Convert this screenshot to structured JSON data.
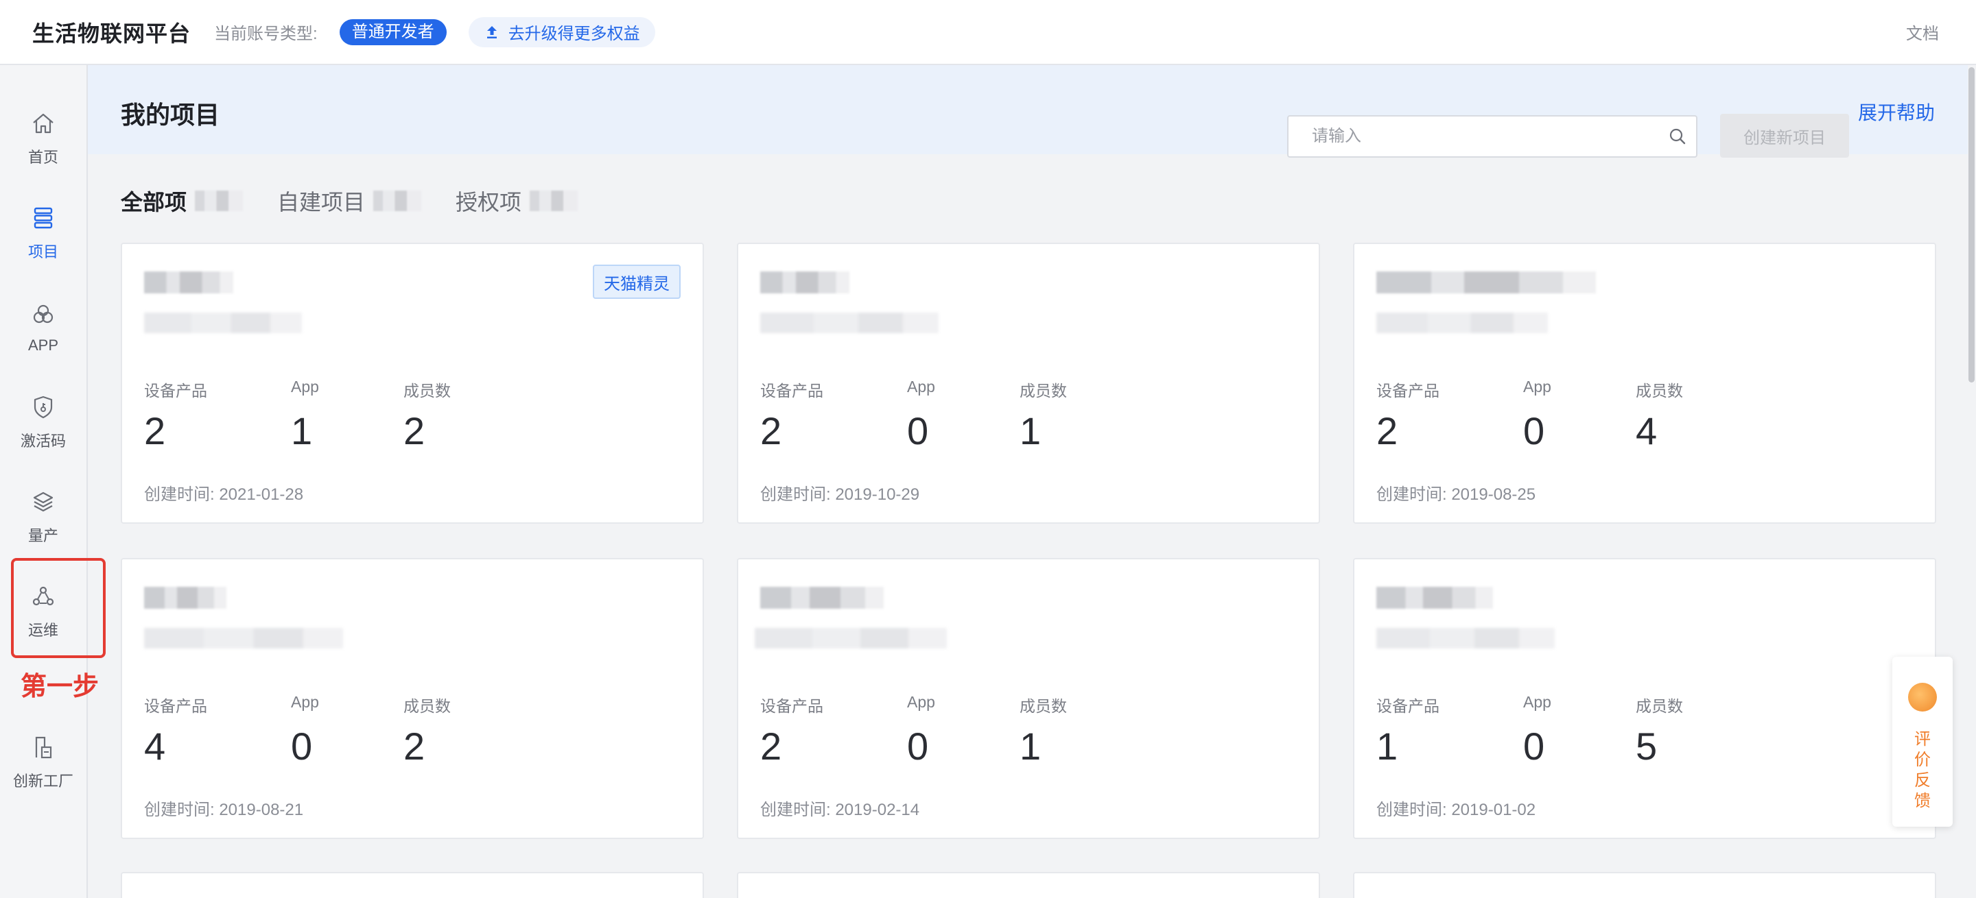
{
  "topbar": {
    "brand": "生活物联网平台",
    "account_label": "当前账号类型:",
    "account_type": "普通开发者",
    "upgrade_label": "去升级得更多权益",
    "docs_label": "文档"
  },
  "sidebar": {
    "items": [
      {
        "label": "首页",
        "icon": "home-icon"
      },
      {
        "label": "项目",
        "icon": "project-icon"
      },
      {
        "label": "APP",
        "icon": "app-icon"
      },
      {
        "label": "激活码",
        "icon": "shield-icon"
      },
      {
        "label": "量产",
        "icon": "layers-icon"
      },
      {
        "label": "运维",
        "icon": "ops-icon"
      },
      {
        "label": "创新工厂",
        "icon": "factory-icon"
      }
    ],
    "active_index": 1,
    "annotation": "第一步"
  },
  "main": {
    "title": "我的项目",
    "help_link": "展开帮助",
    "tabs": [
      {
        "label": "全部项"
      },
      {
        "label": "自建项目"
      },
      {
        "label": "授权项"
      }
    ],
    "search_placeholder": "请输入",
    "create_button": "创建新项目",
    "stat_labels": {
      "products": "设备产品",
      "app": "App",
      "members": "成员数"
    },
    "cards": [
      {
        "tag": "天猫精灵",
        "products": "2",
        "app": "1",
        "members": "2",
        "created": "创建时间: 2021-01-28"
      },
      {
        "tag": "",
        "products": "2",
        "app": "0",
        "members": "1",
        "created": "创建时间: 2019-10-29"
      },
      {
        "tag": "",
        "products": "2",
        "app": "0",
        "members": "4",
        "created": "创建时间: 2019-08-25"
      },
      {
        "tag": "",
        "products": "4",
        "app": "0",
        "members": "2",
        "created": "创建时间: 2019-08-21"
      },
      {
        "tag": "",
        "products": "2",
        "app": "0",
        "members": "1",
        "created": "创建时间: 2019-02-14"
      },
      {
        "tag": "",
        "products": "1",
        "app": "0",
        "members": "5",
        "created": "创建时间: 2019-01-02"
      }
    ]
  },
  "feedback": {
    "label": "评价反馈"
  },
  "colors": {
    "accent": "#2468e8",
    "annotation_red": "#e43b32",
    "feedback_orange": "#f07d2a"
  }
}
